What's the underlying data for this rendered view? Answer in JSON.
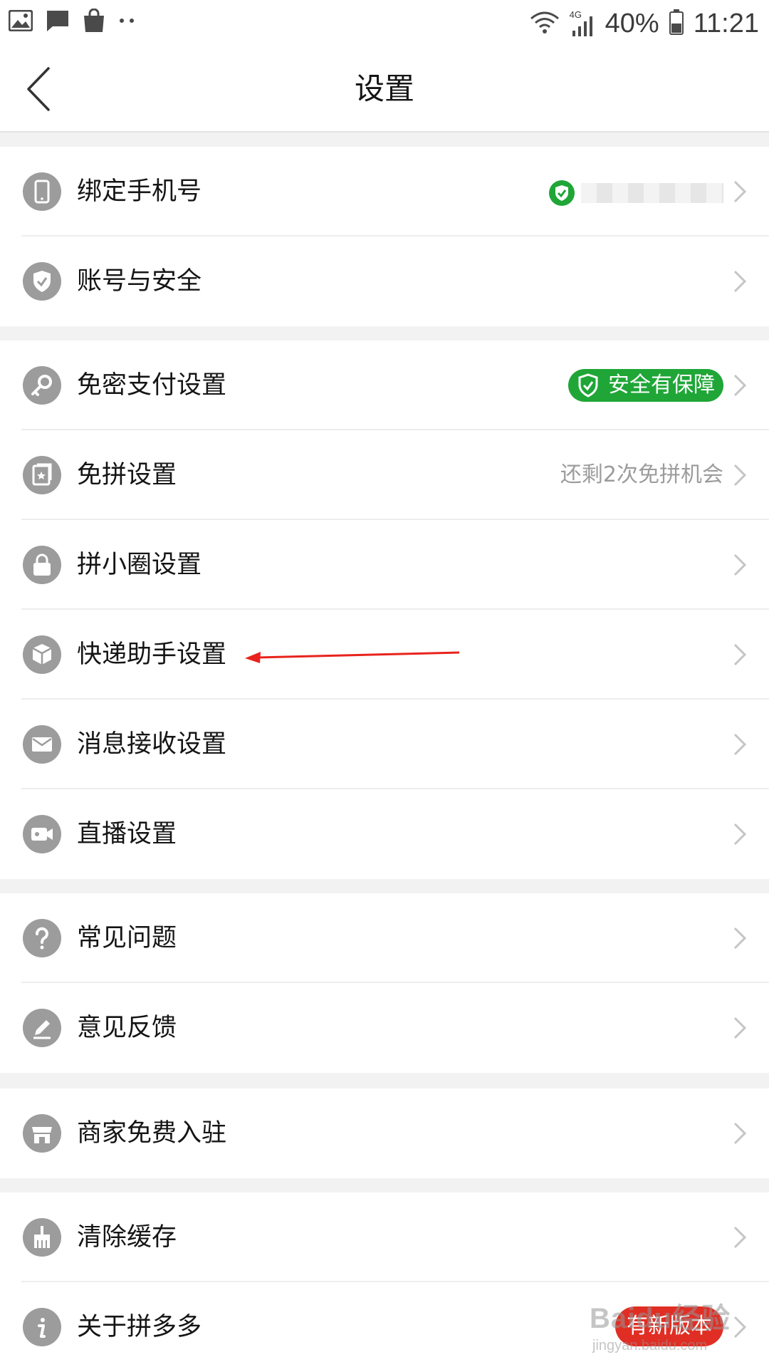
{
  "status_bar": {
    "battery": "40%",
    "time": "11:21",
    "network": "4G",
    "icons": [
      "gallery-icon",
      "message-icon",
      "shopping-bag-icon",
      "more-dots-icon",
      "wifi-icon",
      "signal-icon",
      "battery-icon"
    ]
  },
  "nav": {
    "title": "设置",
    "back_icon": "back-chevron-icon"
  },
  "groups": [
    {
      "items": [
        {
          "label": "绑定手机号",
          "icon": "phone-icon",
          "trailing": "verified-phone"
        },
        {
          "label": "账号与安全",
          "icon": "shield-check-icon"
        }
      ]
    },
    {
      "items": [
        {
          "label": "免密支付设置",
          "icon": "key-icon",
          "badge": "安全有保障"
        },
        {
          "label": "免拼设置",
          "icon": "ticket-icon",
          "value": "还剩2次免拼机会"
        },
        {
          "label": "拼小圈设置",
          "icon": "lock-icon"
        },
        {
          "label": "快递助手设置",
          "icon": "package-icon"
        },
        {
          "label": "消息接收设置",
          "icon": "mail-icon"
        },
        {
          "label": "直播设置",
          "icon": "video-camera-icon"
        }
      ]
    },
    {
      "items": [
        {
          "label": "常见问题",
          "icon": "question-icon"
        },
        {
          "label": "意见反馈",
          "icon": "pencil-icon"
        }
      ]
    },
    {
      "items": [
        {
          "label": "商家免费入驻",
          "icon": "store-icon"
        }
      ]
    },
    {
      "items": [
        {
          "label": "清除缓存",
          "icon": "broom-icon"
        },
        {
          "label": "关于拼多多",
          "icon": "info-icon",
          "update_badge": "有新版本"
        }
      ]
    }
  ],
  "watermark": {
    "main": "Baidu经验",
    "sub": "jingyan.baidu.com"
  },
  "colors": {
    "background": "#f2f2f2",
    "row_background": "#ffffff",
    "icon_gray": "#9c9c9c",
    "safe_green": "#1fa637",
    "update_red": "#e02e24",
    "annotation_red": "#e8231d"
  }
}
